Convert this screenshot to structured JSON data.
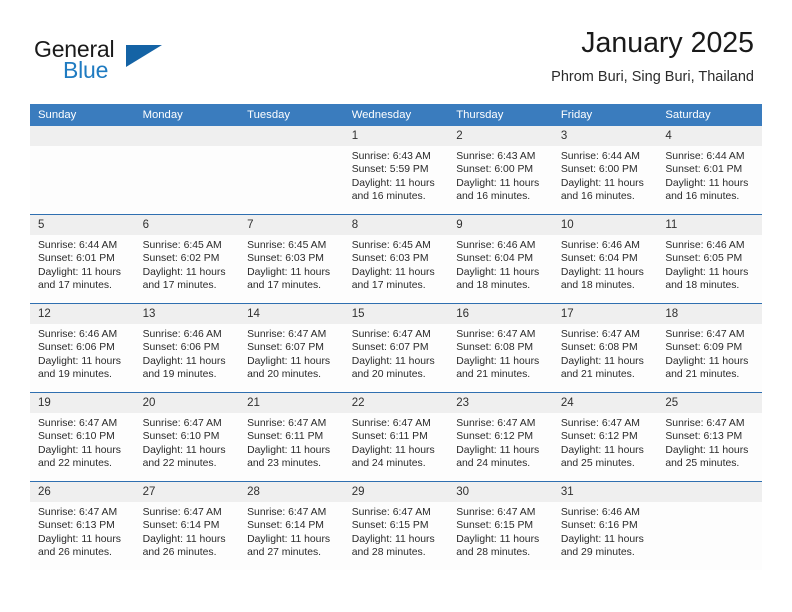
{
  "brand": {
    "name_primary": "General",
    "name_secondary": "Blue",
    "logo_icon": "triangle-logo-icon"
  },
  "header": {
    "title": "January 2025",
    "subtitle": "Phrom Buri, Sing Buri, Thailand"
  },
  "theme": {
    "header_blue": "#3a7cbe",
    "separator_blue": "#2f6fb0",
    "daynum_bg": "#efefef",
    "brand_blue": "#1f7bc1",
    "logo_blue": "#1463a5"
  },
  "weekday_headers": [
    "Sunday",
    "Monday",
    "Tuesday",
    "Wednesday",
    "Thursday",
    "Friday",
    "Saturday"
  ],
  "labels": {
    "sunrise_prefix": "Sunrise:",
    "sunset_prefix": "Sunset:",
    "daylight_prefix": "Daylight:"
  },
  "weeks": [
    [
      {
        "day": "",
        "blank": true
      },
      {
        "day": "",
        "blank": true
      },
      {
        "day": "",
        "blank": true
      },
      {
        "day": "1",
        "sunrise": "Sunrise: 6:43 AM",
        "sunset": "Sunset: 5:59 PM",
        "daylight": "Daylight: 11 hours and 16 minutes."
      },
      {
        "day": "2",
        "sunrise": "Sunrise: 6:43 AM",
        "sunset": "Sunset: 6:00 PM",
        "daylight": "Daylight: 11 hours and 16 minutes."
      },
      {
        "day": "3",
        "sunrise": "Sunrise: 6:44 AM",
        "sunset": "Sunset: 6:00 PM",
        "daylight": "Daylight: 11 hours and 16 minutes."
      },
      {
        "day": "4",
        "sunrise": "Sunrise: 6:44 AM",
        "sunset": "Sunset: 6:01 PM",
        "daylight": "Daylight: 11 hours and 16 minutes."
      }
    ],
    [
      {
        "day": "5",
        "sunrise": "Sunrise: 6:44 AM",
        "sunset": "Sunset: 6:01 PM",
        "daylight": "Daylight: 11 hours and 17 minutes."
      },
      {
        "day": "6",
        "sunrise": "Sunrise: 6:45 AM",
        "sunset": "Sunset: 6:02 PM",
        "daylight": "Daylight: 11 hours and 17 minutes."
      },
      {
        "day": "7",
        "sunrise": "Sunrise: 6:45 AM",
        "sunset": "Sunset: 6:03 PM",
        "daylight": "Daylight: 11 hours and 17 minutes."
      },
      {
        "day": "8",
        "sunrise": "Sunrise: 6:45 AM",
        "sunset": "Sunset: 6:03 PM",
        "daylight": "Daylight: 11 hours and 17 minutes."
      },
      {
        "day": "9",
        "sunrise": "Sunrise: 6:46 AM",
        "sunset": "Sunset: 6:04 PM",
        "daylight": "Daylight: 11 hours and 18 minutes."
      },
      {
        "day": "10",
        "sunrise": "Sunrise: 6:46 AM",
        "sunset": "Sunset: 6:04 PM",
        "daylight": "Daylight: 11 hours and 18 minutes."
      },
      {
        "day": "11",
        "sunrise": "Sunrise: 6:46 AM",
        "sunset": "Sunset: 6:05 PM",
        "daylight": "Daylight: 11 hours and 18 minutes."
      }
    ],
    [
      {
        "day": "12",
        "sunrise": "Sunrise: 6:46 AM",
        "sunset": "Sunset: 6:06 PM",
        "daylight": "Daylight: 11 hours and 19 minutes."
      },
      {
        "day": "13",
        "sunrise": "Sunrise: 6:46 AM",
        "sunset": "Sunset: 6:06 PM",
        "daylight": "Daylight: 11 hours and 19 minutes."
      },
      {
        "day": "14",
        "sunrise": "Sunrise: 6:47 AM",
        "sunset": "Sunset: 6:07 PM",
        "daylight": "Daylight: 11 hours and 20 minutes."
      },
      {
        "day": "15",
        "sunrise": "Sunrise: 6:47 AM",
        "sunset": "Sunset: 6:07 PM",
        "daylight": "Daylight: 11 hours and 20 minutes."
      },
      {
        "day": "16",
        "sunrise": "Sunrise: 6:47 AM",
        "sunset": "Sunset: 6:08 PM",
        "daylight": "Daylight: 11 hours and 21 minutes."
      },
      {
        "day": "17",
        "sunrise": "Sunrise: 6:47 AM",
        "sunset": "Sunset: 6:08 PM",
        "daylight": "Daylight: 11 hours and 21 minutes."
      },
      {
        "day": "18",
        "sunrise": "Sunrise: 6:47 AM",
        "sunset": "Sunset: 6:09 PM",
        "daylight": "Daylight: 11 hours and 21 minutes."
      }
    ],
    [
      {
        "day": "19",
        "sunrise": "Sunrise: 6:47 AM",
        "sunset": "Sunset: 6:10 PM",
        "daylight": "Daylight: 11 hours and 22 minutes."
      },
      {
        "day": "20",
        "sunrise": "Sunrise: 6:47 AM",
        "sunset": "Sunset: 6:10 PM",
        "daylight": "Daylight: 11 hours and 22 minutes."
      },
      {
        "day": "21",
        "sunrise": "Sunrise: 6:47 AM",
        "sunset": "Sunset: 6:11 PM",
        "daylight": "Daylight: 11 hours and 23 minutes."
      },
      {
        "day": "22",
        "sunrise": "Sunrise: 6:47 AM",
        "sunset": "Sunset: 6:11 PM",
        "daylight": "Daylight: 11 hours and 24 minutes."
      },
      {
        "day": "23",
        "sunrise": "Sunrise: 6:47 AM",
        "sunset": "Sunset: 6:12 PM",
        "daylight": "Daylight: 11 hours and 24 minutes."
      },
      {
        "day": "24",
        "sunrise": "Sunrise: 6:47 AM",
        "sunset": "Sunset: 6:12 PM",
        "daylight": "Daylight: 11 hours and 25 minutes."
      },
      {
        "day": "25",
        "sunrise": "Sunrise: 6:47 AM",
        "sunset": "Sunset: 6:13 PM",
        "daylight": "Daylight: 11 hours and 25 minutes."
      }
    ],
    [
      {
        "day": "26",
        "sunrise": "Sunrise: 6:47 AM",
        "sunset": "Sunset: 6:13 PM",
        "daylight": "Daylight: 11 hours and 26 minutes."
      },
      {
        "day": "27",
        "sunrise": "Sunrise: 6:47 AM",
        "sunset": "Sunset: 6:14 PM",
        "daylight": "Daylight: 11 hours and 26 minutes."
      },
      {
        "day": "28",
        "sunrise": "Sunrise: 6:47 AM",
        "sunset": "Sunset: 6:14 PM",
        "daylight": "Daylight: 11 hours and 27 minutes."
      },
      {
        "day": "29",
        "sunrise": "Sunrise: 6:47 AM",
        "sunset": "Sunset: 6:15 PM",
        "daylight": "Daylight: 11 hours and 28 minutes."
      },
      {
        "day": "30",
        "sunrise": "Sunrise: 6:47 AM",
        "sunset": "Sunset: 6:15 PM",
        "daylight": "Daylight: 11 hours and 28 minutes."
      },
      {
        "day": "31",
        "sunrise": "Sunrise: 6:46 AM",
        "sunset": "Sunset: 6:16 PM",
        "daylight": "Daylight: 11 hours and 29 minutes."
      },
      {
        "day": "",
        "blank": true
      }
    ]
  ]
}
